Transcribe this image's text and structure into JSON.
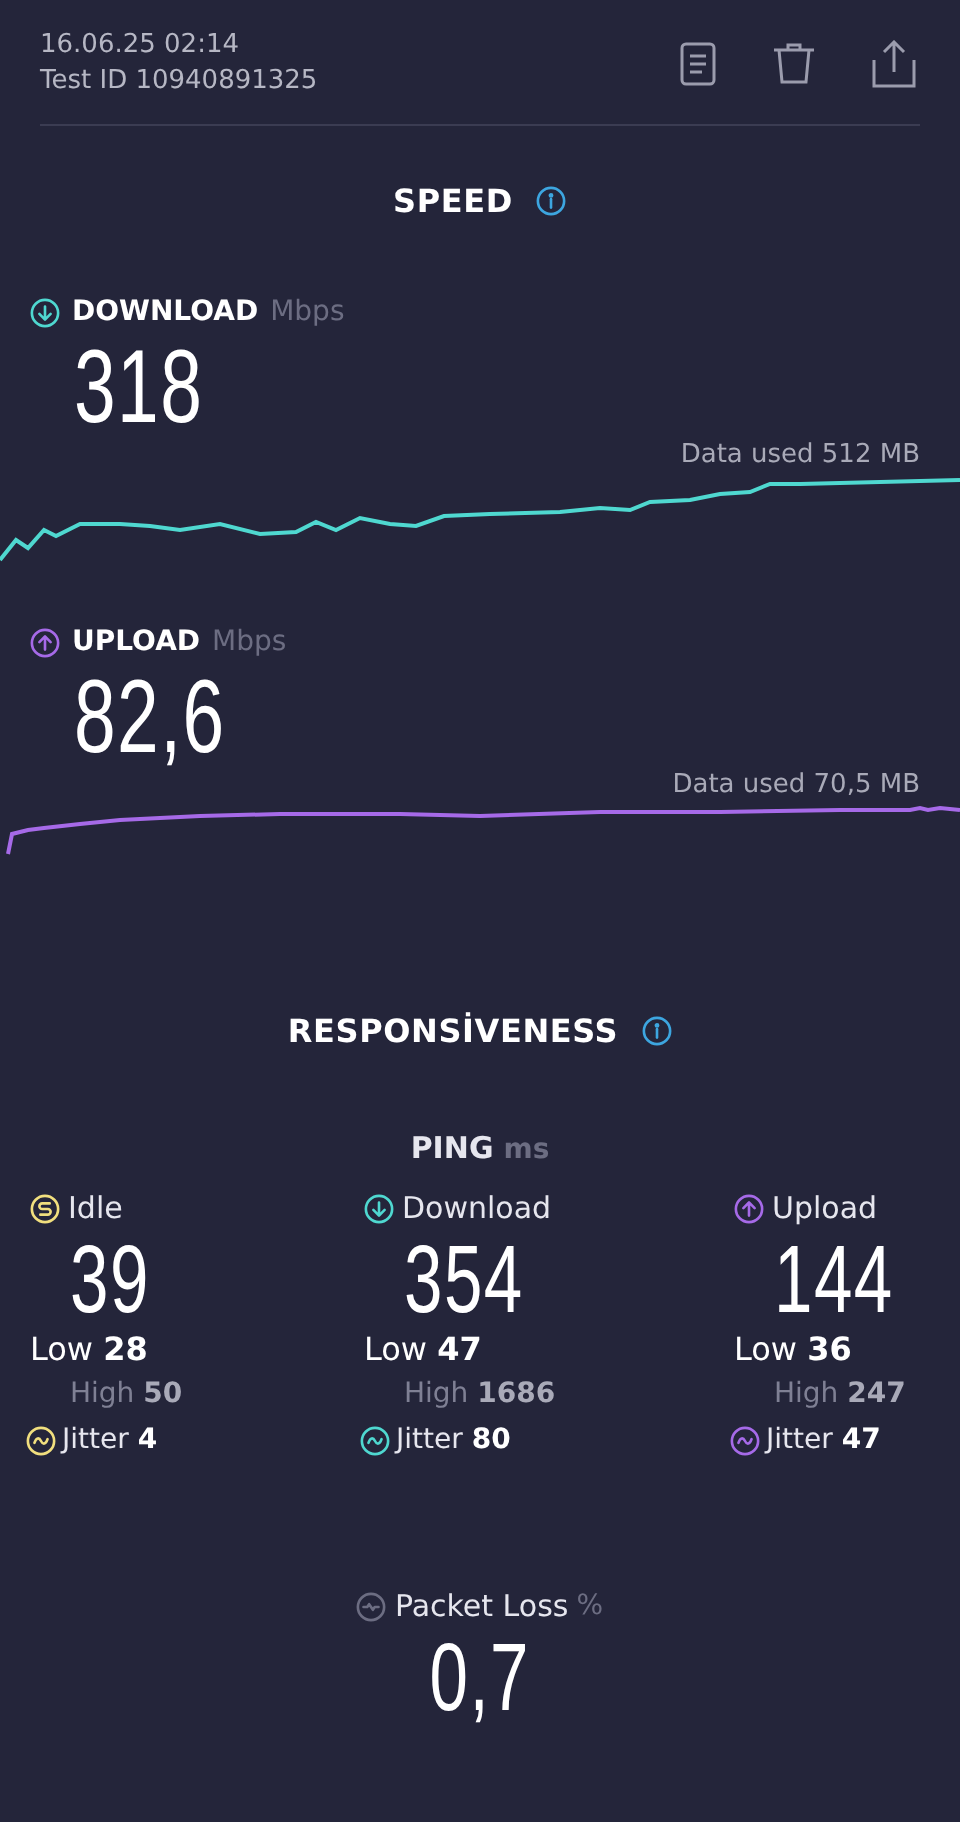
{
  "header": {
    "date": "16.06.25 02:14",
    "test_id": "Test ID 10940891325"
  },
  "speed": {
    "title": "SPEED",
    "tests": [
      {
        "kind": "download",
        "label": "DOWNLOAD",
        "unit": "Mbps",
        "value": "318",
        "data_used": "Data used 512 MB",
        "color": "#4fd8d0"
      },
      {
        "kind": "upload",
        "label": "UPLOAD",
        "unit": "Mbps",
        "value": "82,6",
        "data_used": "Data used 70,5 MB",
        "color": "#a66ae8"
      }
    ]
  },
  "responsiveness": {
    "title": "RESPONSİVENESS",
    "ping_label": "PING",
    "ping_unit": "ms",
    "columns": [
      {
        "kind": "idle",
        "label": "Idle",
        "value": "39",
        "low": "Low **28**",
        "high": "High **50**",
        "jitter": "Jitter **4**",
        "color": "#f1df7e"
      },
      {
        "kind": "download",
        "label": "Download",
        "value": "354",
        "low": "Low **47**",
        "high": "High **1686**",
        "jitter": "Jitter **80**",
        "color": "#4fd8d0"
      },
      {
        "kind": "upload",
        "label": "Upload",
        "value": "144",
        "low": "Low **36**",
        "high": "High **247**",
        "jitter": "Jitter **47**",
        "color": "#a66ae8"
      }
    ]
  },
  "packet_loss": {
    "label": "Packet Loss",
    "unit": "%",
    "value": "0,7"
  }
}
